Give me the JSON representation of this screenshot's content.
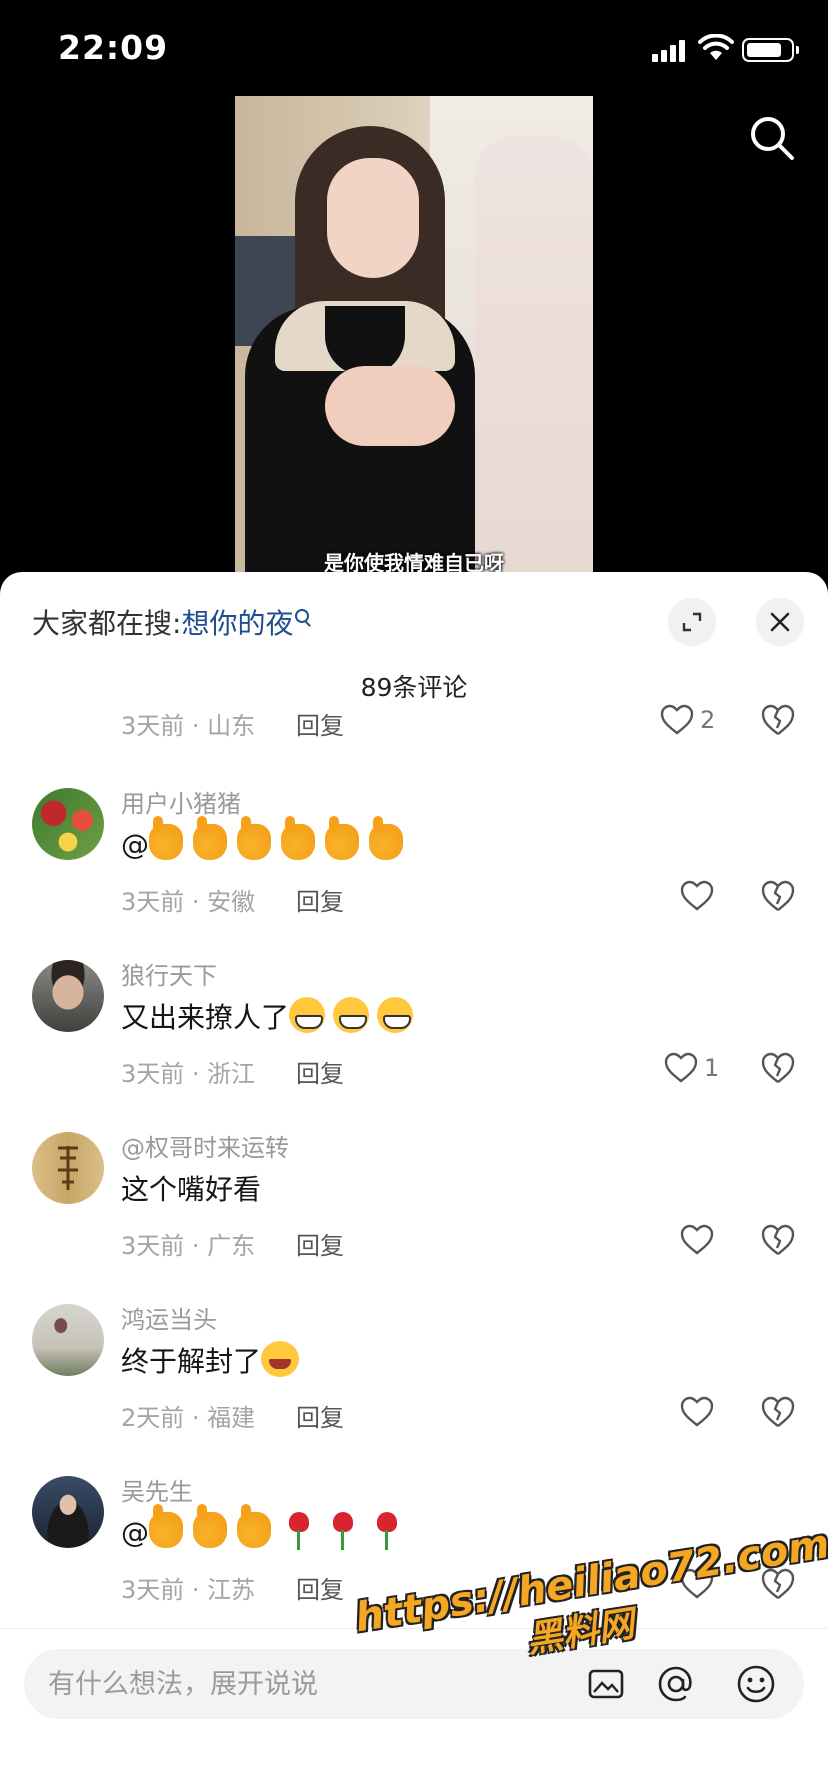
{
  "status_bar": {
    "time": "22:09"
  },
  "video": {
    "subtitle": "是你使我情难自已呀"
  },
  "sheet": {
    "trending_prefix": "大家都在搜:",
    "trending_keyword": "想你的夜",
    "comment_count": "89条评论"
  },
  "comments": {
    "partial": {
      "meta": "3天前 · 山东",
      "reply": "回复",
      "likes": "2"
    },
    "items": [
      {
        "username": "用户小猪猪",
        "text_prefix": "@",
        "emojis": [
          "thumbs-up",
          "thumbs-up",
          "thumbs-up",
          "thumbs-up",
          "thumbs-up",
          "thumbs-up"
        ],
        "meta": "3天前 · 安徽",
        "reply": "回复",
        "likes": ""
      },
      {
        "username": "狼行天下",
        "text": "又出来撩人了",
        "emojis": [
          "grinning-face",
          "grinning-face",
          "grinning-face"
        ],
        "meta": "3天前 · 浙江",
        "reply": "回复",
        "likes": "1"
      },
      {
        "username": "@权哥时来运转",
        "text": "这个嘴好看",
        "meta": "3天前 · 广东",
        "reply": "回复",
        "likes": ""
      },
      {
        "username": "鸿运当头",
        "text": "终于解封了",
        "emojis": [
          "laughing-crying-face"
        ],
        "meta": "2天前 · 福建",
        "reply": "回复",
        "likes": ""
      },
      {
        "username": "吴先生",
        "text_prefix": "@",
        "emojis": [
          "thumbs-up",
          "thumbs-up",
          "thumbs-up",
          "rose",
          "rose",
          "rose"
        ],
        "meta": "3天前 · 江苏",
        "reply": "回复",
        "likes": ""
      }
    ]
  },
  "input": {
    "placeholder": "有什么想法，展开说说"
  },
  "watermark": {
    "url": "https://heiliao72.com",
    "brand": "黑料网"
  },
  "colors": {
    "accent_link": "#1d4f8f",
    "watermark": "#f5a623"
  }
}
